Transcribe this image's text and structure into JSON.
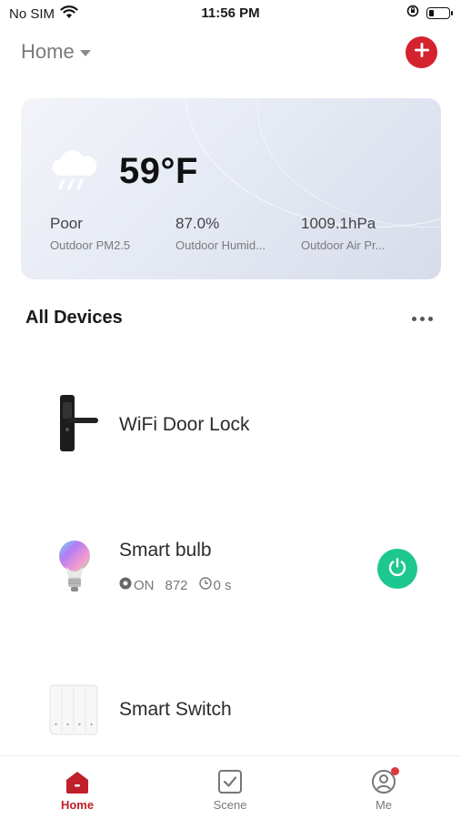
{
  "status_bar": {
    "carrier": "No SIM",
    "time": "11:56 PM",
    "battery_level": 0.25
  },
  "header": {
    "home_label": "Home",
    "add_icon": "plus-icon",
    "accent_color": "#d4232f"
  },
  "weather": {
    "icon": "rain-cloud-icon",
    "temperature": "59°F",
    "stats": [
      {
        "value": "Poor",
        "label": "Outdoor PM2.5"
      },
      {
        "value": "87.0%",
        "label": "Outdoor Humid..."
      },
      {
        "value": "1009.1hPa",
        "label": "Outdoor Air Pr..."
      }
    ]
  },
  "devices_section": {
    "title": "All Devices",
    "more_icon": "more-dots-icon"
  },
  "devices": [
    {
      "name": "WiFi Door Lock",
      "icon": "door-lock-icon"
    },
    {
      "name": "Smart bulb",
      "icon": "bulb-icon",
      "status": "ON",
      "value": "872",
      "timer": "0 s",
      "power_icon": "power-icon",
      "power_color": "#1ec78f"
    },
    {
      "name": "Smart Switch",
      "icon": "switch-icon"
    }
  ],
  "tabs": [
    {
      "label": "Home",
      "icon": "home-icon",
      "active": true
    },
    {
      "label": "Scene",
      "icon": "scene-check-icon",
      "active": false
    },
    {
      "label": "Me",
      "icon": "profile-icon",
      "active": false,
      "notification": true
    }
  ]
}
